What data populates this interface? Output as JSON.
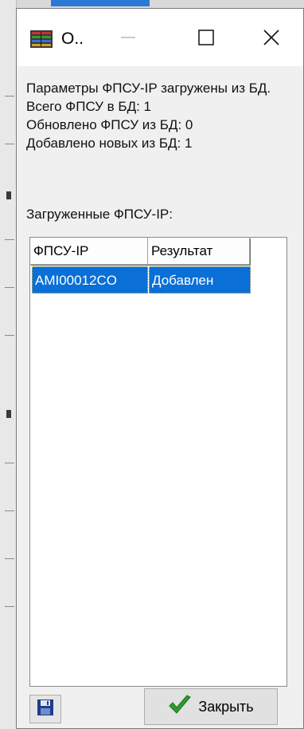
{
  "window": {
    "title": "O..",
    "icon": "server-list-icon",
    "controls": [
      "minimize-icon",
      "maximize-icon",
      "close-icon"
    ]
  },
  "info": {
    "line1": "Параметры ФПСУ-IP загружены из БД.",
    "line2": "Всего ФПСУ в БД: 1",
    "line3": "Обновлено ФПСУ из БД: 0",
    "line4": "Добавлено новых из БД: 1"
  },
  "loaded_label": "Загруженные ФПСУ-IP:",
  "table": {
    "columns": [
      "ФПСУ-IP",
      "Результат"
    ],
    "rows": [
      [
        "AMI00012CO",
        "Добавлен"
      ]
    ]
  },
  "buttons": {
    "save_icon": "floppy-disk-icon",
    "close_label": "Закрыть",
    "close_icon": "checkmark-icon"
  },
  "colors": {
    "selection": "#0a6fd6",
    "check": "#2e9c2e"
  }
}
